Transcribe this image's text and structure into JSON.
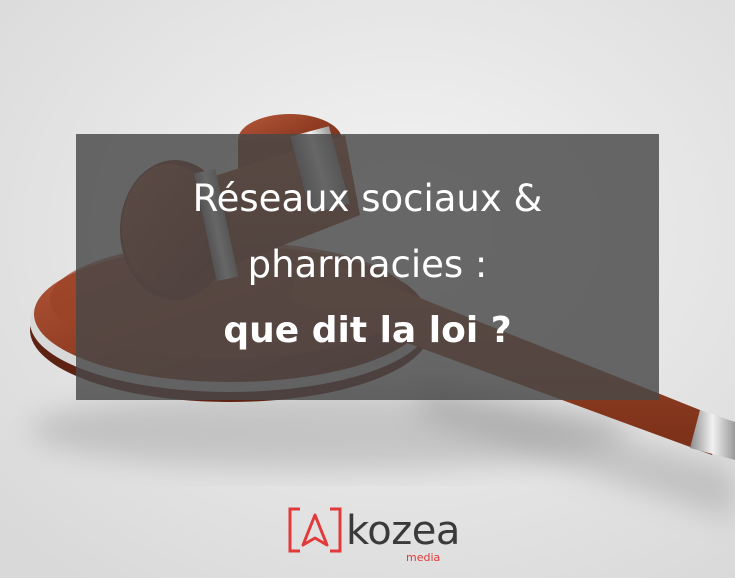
{
  "headline": {
    "line1": "Réseaux sociaux &",
    "line2": "pharmacies :",
    "line3": "que dit la loi ?"
  },
  "logo": {
    "word": "kozea",
    "subtitle": "media",
    "accent_color": "#e23a3a"
  },
  "image": {
    "subject": "gavel-icon"
  }
}
